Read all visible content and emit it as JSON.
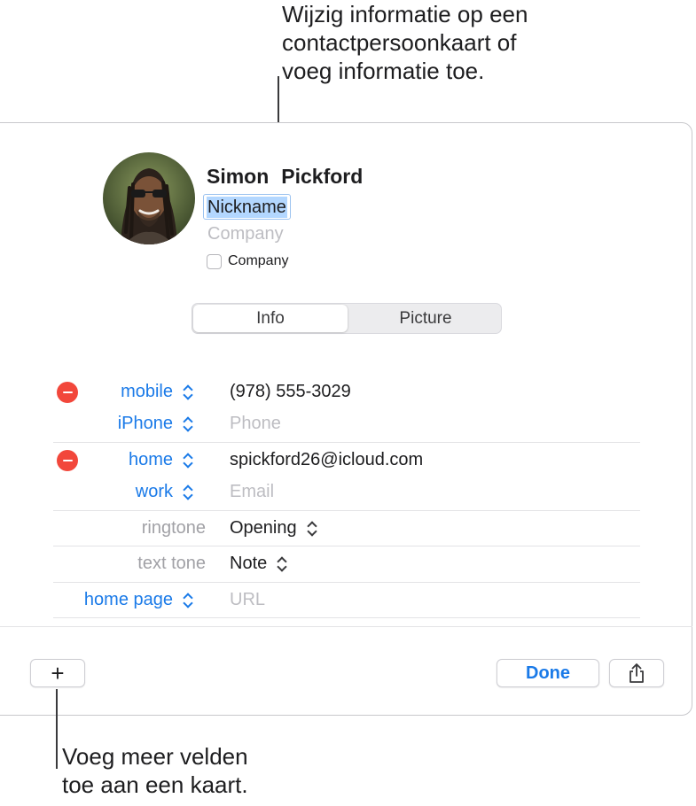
{
  "callouts": {
    "top": "Wijzig informatie op een\ncontactpersoonkaart of\nvoeg informatie toe.",
    "bottom": "Voeg meer velden\ntoe aan een kaart."
  },
  "contact": {
    "first_name": "Simon",
    "last_name": "Pickford",
    "nickname": "Nickname",
    "company_placeholder": "Company",
    "company_checkbox_label": "Company"
  },
  "tabs": [
    {
      "label": "Info",
      "selected": true
    },
    {
      "label": "Picture",
      "selected": false
    }
  ],
  "fields": {
    "phone": [
      {
        "label": "mobile",
        "value": "(978) 555-3029",
        "placeholder": false
      },
      {
        "label": "iPhone",
        "value": "Phone",
        "placeholder": true
      }
    ],
    "email": [
      {
        "label": "home",
        "value": "spickford26@icloud.com",
        "placeholder": false
      },
      {
        "label": "work",
        "value": "Email",
        "placeholder": true
      }
    ],
    "ringtone": {
      "label": "ringtone",
      "value": "Opening"
    },
    "text_tone": {
      "label": "text tone",
      "value": "Note"
    },
    "home_page": {
      "label": "home page",
      "value": "URL",
      "placeholder": true
    }
  },
  "footer": {
    "add_label": "+",
    "done_label": "Done"
  },
  "colors": {
    "accent": "#1a7ae8",
    "remove": "#f2473b",
    "selection": "#b3d7ff"
  }
}
